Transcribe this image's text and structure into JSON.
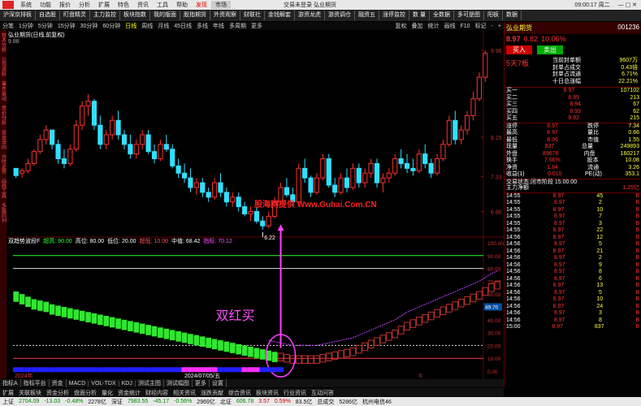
{
  "window": {
    "title": "交易未登录  弘业期货",
    "menus": [
      "系统",
      "功能",
      "报价",
      "分析",
      "扩展",
      "特色",
      "资讯",
      "工具",
      "帮助"
    ],
    "tabs": [
      "发现",
      "市场"
    ],
    "time": "09:00:17 周二"
  },
  "toolbar": [
    "沪深京排板",
    "自选股",
    "盯盘精灵",
    "主力监控",
    "板块指数",
    "我的版面",
    "股指期货",
    "外资观察",
    "财联社",
    "金钱解套",
    "游资龙虎",
    "游资调仓",
    "融资五",
    "涨停监控",
    "数 量",
    "全数据",
    "多可是图",
    "阳板",
    "数据"
  ],
  "periods": [
    "分笔",
    "1分钟",
    "5分钟",
    "15分钟",
    "30分钟",
    "60分钟",
    "日线",
    "周线",
    "月线",
    "45日线",
    "多线",
    "年线",
    "多周期",
    "更多"
  ],
  "periods_right": [
    "复权",
    "叠加",
    "统计",
    "画线",
    "F10",
    "标记",
    "-",
    "+"
  ],
  "left_tabs": [
    "技术分析",
    "公司资料",
    "事件驱动",
    "竞价分析",
    "资金流向",
    "分时走势",
    "画线工具",
    "多股同列"
  ],
  "chart_info": {
    "title": "弘业期货(日线,前复权)",
    "value": "9.88"
  },
  "watermark": "股海网提供 Www.Guhai.Com.CN",
  "annotation": "双红买",
  "low_label": "6.22",
  "price_axis": [
    "9.96",
    "8.15",
    "7.33",
    "6.60"
  ],
  "ind_axis": [
    "100.00",
    "90.00",
    "80.00",
    "70.00",
    "60.00",
    "50.00",
    "40.00",
    "30.00",
    "20.00",
    "10.00",
    "0.00"
  ],
  "indicator": {
    "name": "双趋势波段F",
    "items": [
      {
        "label": "超高:",
        "value": "90.00",
        "color": "#3f3"
      },
      {
        "label": "高位:",
        "value": "80.00",
        "color": "#fff"
      },
      {
        "label": "低位:",
        "value": "20.00",
        "color": "#fff"
      },
      {
        "label": "超低:",
        "value": "10.00",
        "color": "#f55"
      },
      {
        "label": "中值:",
        "value": "68.42",
        "color": "#fff"
      },
      {
        "label": "指标:",
        "value": "70.12",
        "color": "#f5f"
      }
    ]
  },
  "ind_right_value": "49.70",
  "chart_data": {
    "type": "candlestick",
    "price_ticks": [
      9.96,
      8.15,
      7.33,
      6.6
    ],
    "ohlc": [
      [
        7.5,
        7.5,
        7.3,
        7.35
      ],
      [
        7.4,
        7.5,
        7.3,
        7.45
      ],
      [
        7.45,
        7.7,
        7.4,
        7.6
      ],
      [
        7.6,
        7.9,
        7.55,
        7.85
      ],
      [
        7.85,
        8.2,
        7.8,
        8.1
      ],
      [
        8.1,
        8.4,
        8.0,
        8.3
      ],
      [
        8.3,
        8.3,
        7.9,
        8.0
      ],
      [
        8.0,
        8.1,
        7.6,
        7.7
      ],
      [
        7.7,
        7.9,
        7.5,
        7.6
      ],
      [
        7.6,
        8.0,
        7.55,
        7.9
      ],
      [
        7.9,
        8.5,
        7.85,
        8.4
      ],
      [
        8.4,
        8.9,
        8.3,
        8.8
      ],
      [
        8.8,
        9.05,
        8.6,
        8.9
      ],
      [
        8.9,
        8.95,
        8.3,
        8.4
      ],
      [
        8.4,
        8.6,
        7.9,
        8.0
      ],
      [
        8.0,
        8.3,
        7.9,
        8.2
      ],
      [
        8.2,
        8.6,
        8.1,
        8.5
      ],
      [
        8.5,
        8.7,
        8.1,
        8.2
      ],
      [
        8.2,
        8.3,
        7.9,
        8.0
      ],
      [
        8.0,
        8.2,
        7.7,
        7.8
      ],
      [
        7.8,
        8.1,
        7.7,
        8.0
      ],
      [
        8.0,
        8.3,
        7.9,
        8.2
      ],
      [
        8.2,
        8.3,
        7.8,
        7.85
      ],
      [
        7.85,
        8.0,
        7.6,
        7.7
      ],
      [
        7.7,
        8.1,
        7.65,
        8.0
      ],
      [
        8.0,
        8.2,
        7.85,
        7.9
      ],
      [
        7.9,
        8.0,
        7.5,
        7.55
      ],
      [
        7.55,
        7.7,
        7.3,
        7.4
      ],
      [
        7.4,
        7.6,
        7.2,
        7.3
      ],
      [
        7.3,
        7.5,
        7.0,
        7.1
      ],
      [
        7.1,
        7.3,
        6.95,
        7.2
      ],
      [
        7.2,
        7.3,
        6.9,
        7.0
      ],
      [
        7.0,
        7.1,
        6.8,
        6.9
      ],
      [
        6.9,
        7.3,
        6.85,
        7.2
      ],
      [
        7.2,
        7.4,
        6.9,
        7.0
      ],
      [
        7.0,
        7.1,
        6.7,
        6.8
      ],
      [
        6.8,
        7.0,
        6.7,
        6.9
      ],
      [
        6.9,
        7.0,
        6.6,
        6.7
      ],
      [
        6.7,
        6.8,
        6.5,
        6.55
      ],
      [
        6.55,
        6.7,
        6.4,
        6.6
      ],
      [
        6.6,
        6.7,
        6.35,
        6.4
      ],
      [
        6.4,
        6.5,
        6.22,
        6.3
      ],
      [
        6.3,
        6.6,
        6.25,
        6.5
      ],
      [
        6.5,
        6.9,
        6.45,
        6.8
      ],
      [
        6.8,
        7.2,
        6.75,
        7.1
      ],
      [
        7.1,
        7.3,
        6.9,
        6.95
      ],
      [
        6.95,
        7.1,
        6.7,
        6.8
      ],
      [
        6.8,
        7.6,
        6.75,
        7.5
      ],
      [
        7.5,
        7.7,
        7.2,
        7.3
      ],
      [
        7.3,
        7.35,
        6.9,
        7.0
      ],
      [
        7.0,
        7.4,
        6.95,
        7.3
      ],
      [
        7.3,
        7.8,
        7.25,
        7.7
      ],
      [
        7.7,
        7.8,
        7.1,
        7.15
      ],
      [
        7.15,
        7.3,
        6.9,
        7.0
      ],
      [
        7.0,
        7.4,
        6.95,
        7.3
      ],
      [
        7.3,
        7.5,
        7.0,
        7.1
      ],
      [
        7.1,
        7.6,
        7.05,
        7.5
      ],
      [
        7.5,
        7.6,
        7.1,
        7.2
      ],
      [
        7.2,
        7.5,
        7.1,
        7.4
      ],
      [
        7.4,
        7.7,
        7.3,
        7.6
      ],
      [
        7.6,
        7.7,
        7.1,
        7.2
      ],
      [
        7.2,
        7.4,
        7.0,
        7.3
      ],
      [
        7.3,
        7.5,
        7.2,
        7.4
      ],
      [
        7.4,
        7.8,
        7.35,
        7.7
      ],
      [
        7.7,
        7.9,
        7.5,
        7.6
      ],
      [
        7.6,
        7.8,
        7.4,
        7.5
      ],
      [
        7.5,
        7.7,
        7.35,
        7.45
      ],
      [
        7.45,
        7.9,
        7.4,
        7.8
      ],
      [
        7.8,
        8.0,
        7.5,
        7.6
      ],
      [
        7.6,
        7.7,
        7.3,
        7.4
      ],
      [
        7.4,
        7.8,
        7.35,
        7.7
      ],
      [
        7.7,
        8.1,
        7.65,
        8.0
      ],
      [
        8.0,
        8.6,
        7.95,
        8.5
      ],
      [
        8.5,
        8.7,
        8.0,
        8.1
      ],
      [
        8.1,
        8.4,
        8.0,
        8.3
      ],
      [
        8.3,
        8.7,
        8.2,
        8.6
      ],
      [
        8.6,
        9.1,
        8.5,
        8.95
      ],
      [
        8.95,
        9.5,
        8.9,
        9.4
      ],
      [
        9.4,
        9.96,
        9.3,
        9.9
      ]
    ],
    "indicator_values": [
      62,
      60,
      58,
      56,
      55,
      54,
      52,
      51,
      50,
      49,
      48,
      47,
      46,
      45,
      44,
      43,
      42,
      41,
      40,
      39,
      38,
      37,
      36,
      35,
      34,
      33,
      32,
      31,
      30,
      29,
      28,
      27,
      26,
      25,
      24,
      23,
      22,
      21,
      20,
      19,
      18,
      17,
      16,
      15,
      14,
      13,
      12,
      12,
      12,
      12,
      12,
      13,
      14,
      15,
      16,
      17,
      18,
      20,
      22,
      24,
      26,
      28,
      30,
      32,
      35,
      38,
      40,
      42,
      44,
      46,
      48,
      50,
      52,
      54,
      56,
      58,
      60,
      62,
      65,
      68,
      70
    ],
    "ind_ticks": [
      100,
      90,
      80,
      70,
      60,
      50,
      40,
      30,
      20,
      10,
      0
    ],
    "levels": {
      "超高": 90,
      "高位": 80,
      "低位": 20,
      "超低": 10
    },
    "signal_index": 44,
    "low_index": 41,
    "xlabels": [
      "2024年",
      "2024/07/05/五",
      "6"
    ]
  },
  "right_panel": {
    "name": "弘业期货",
    "code": "001236",
    "price": "8.97",
    "change": "0.82",
    "pct": "10.06%",
    "buy_btn": "买入",
    "sell_btn": "卖出",
    "chg_label": "5天7板",
    "news": [
      {
        "k": "当前封单额",
        "v": "9607万"
      },
      {
        "k": "封单占成交",
        "v": "0.43倍"
      },
      {
        "k": "封单占流通",
        "v": "6.71%"
      },
      {
        "k": "十日总涨幅",
        "v": "22.21%"
      }
    ],
    "asks": [
      {
        "l": "卖五",
        "p": "--",
        "v": "--"
      },
      {
        "l": "卖四",
        "p": "--",
        "v": "--"
      },
      {
        "l": "卖三",
        "p": "--",
        "v": "--"
      },
      {
        "l": "卖二",
        "p": "--",
        "v": "--"
      },
      {
        "l": "卖一",
        "p": "--",
        "v": "--"
      }
    ],
    "bids": [
      {
        "l": "买一",
        "p": "8.97",
        "v": "107102"
      },
      {
        "l": "买二",
        "p": "8.95",
        "v": "213"
      },
      {
        "l": "买三",
        "p": "8.94",
        "v": "67"
      },
      {
        "l": "买四",
        "p": "8.93",
        "v": "62"
      },
      {
        "l": "买五",
        "p": "8.92",
        "v": "215"
      }
    ],
    "stats": [
      {
        "a": "涨停",
        "av": "8.97",
        "b": "跌停",
        "bv": "7.34"
      },
      {
        "a": "最高",
        "av": "8.97",
        "b": "量比",
        "bv": "0.66"
      },
      {
        "a": "最低",
        "av": "8.06",
        "b": "市值",
        "bv": "1.55"
      },
      {
        "a": "现量",
        "av": "837",
        "b": "总量",
        "bv": "249893"
      },
      {
        "a": "外盘",
        "av": "89676",
        "b": "内盘",
        "bv": "160217"
      },
      {
        "a": "换手",
        "av": "7.66%",
        "b": "股本",
        "bv": "10.08"
      },
      {
        "a": "净资",
        "av": "1.84",
        "b": "流通",
        "bv": "3.26"
      },
      {
        "a": "收益(1)",
        "av": "0.010",
        "b": "PE(动)",
        "bv": "353.1"
      }
    ],
    "status": "交易状态:闭市阶段 15:00:00",
    "flow": "主力净额",
    "flow_val": "1.25亿",
    "trades": [
      {
        "t": "14:55",
        "p": "8.97",
        "v": "45",
        "d": "B"
      },
      {
        "t": "14:55",
        "p": "8.97",
        "v": "2",
        "d": "B"
      },
      {
        "t": "14:55",
        "p": "8.97",
        "v": "10",
        "d": "B"
      },
      {
        "t": "14:55",
        "p": "8.97",
        "v": "7",
        "d": "B"
      },
      {
        "t": "14:55",
        "p": "8.97",
        "v": "3",
        "d": "B"
      },
      {
        "t": "14:55",
        "p": "8.97",
        "v": "22",
        "d": "B"
      },
      {
        "t": "14:56",
        "p": "8.97",
        "v": "12",
        "d": "B"
      },
      {
        "t": "14:56",
        "p": "8.97",
        "v": "5",
        "d": "B"
      },
      {
        "t": "14:56",
        "p": "8.97",
        "v": "21",
        "d": "B"
      },
      {
        "t": "14:56",
        "p": "8.97",
        "v": "2",
        "d": "B"
      },
      {
        "t": "14:56",
        "p": "8.97",
        "v": "9",
        "d": "B"
      },
      {
        "t": "14:56",
        "p": "8.97",
        "v": "8",
        "d": "B"
      },
      {
        "t": "14:56",
        "p": "8.97",
        "v": "6",
        "d": "B"
      },
      {
        "t": "14:56",
        "p": "8.97",
        "v": "13",
        "d": "B"
      },
      {
        "t": "14:56",
        "p": "8.97",
        "v": "5",
        "d": "B"
      },
      {
        "t": "14:56",
        "p": "8.97",
        "v": "10",
        "d": "B"
      },
      {
        "t": "14:56",
        "p": "8.97",
        "v": "24",
        "d": "B"
      },
      {
        "t": "14:56",
        "p": "8.97",
        "v": "3",
        "d": "B"
      },
      {
        "t": "14:56",
        "p": "8.97",
        "v": "8",
        "d": "B"
      },
      {
        "t": "15:00",
        "p": "8.97",
        "v": "837",
        "d": "B"
      }
    ]
  },
  "bottom_tabs": [
    "指标A",
    "指标平台",
    "资金",
    "MACD",
    "VOL-TDX",
    "KDJ",
    "测试主图",
    "测试幅图",
    "更多",
    "设置"
  ],
  "bottom_tabs2": [
    "扩展",
    "关联板块",
    "资金分析",
    "盘面分析",
    "量化",
    "资金统计",
    "财经内容",
    "相关资讯",
    "涨跌贡献",
    "综合资讯",
    "板块资讯",
    "行业资讯",
    "互动问答"
  ],
  "status_items": [
    {
      "l": "上证",
      "v": "2704.09",
      "c": "-13.03",
      "p": "-0.48%",
      "a": "2278亿"
    },
    {
      "l": "深证",
      "v": "7983.55",
      "c": "-45.17",
      "p": "-0.56%",
      "a": "2969亿"
    },
    {
      "l": "北证",
      "v": "606.78",
      "c": "3.57",
      "p": "0.59%",
      "a": "83.5亿"
    }
  ],
  "status_extra": [
    "总成交",
    "5286亿",
    "杭州电信46"
  ]
}
